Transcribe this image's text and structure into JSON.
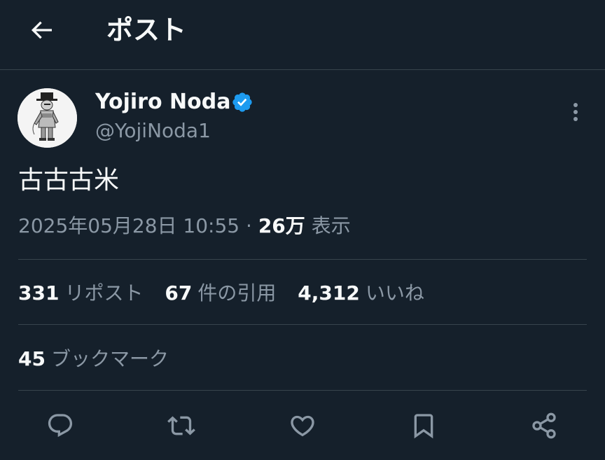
{
  "header": {
    "title": "ポスト",
    "back_icon": "arrow-left-icon"
  },
  "author": {
    "name": "Yojiro Noda",
    "handle": "@YojiNoda1",
    "verified": true,
    "verified_color": "#1d9bf0"
  },
  "tweet": {
    "text": "古古古米",
    "datetime": "2025年05月28日 10:55",
    "separator": "·",
    "views_count": "26万",
    "views_label": "表示"
  },
  "stats": {
    "reposts_count": "331",
    "reposts_label": "リポスト",
    "quotes_count": "67",
    "quotes_label": "件の引用",
    "likes_count": "4,312",
    "likes_label": "いいね",
    "bookmarks_count": "45",
    "bookmarks_label": "ブックマーク"
  },
  "actions": [
    "reply-icon",
    "repost-icon",
    "like-icon",
    "bookmark-icon",
    "share-icon"
  ],
  "colors": {
    "background": "#15202b",
    "text_primary": "#f7f9f9",
    "text_secondary": "#8b98a5",
    "divider": "#38444d"
  }
}
